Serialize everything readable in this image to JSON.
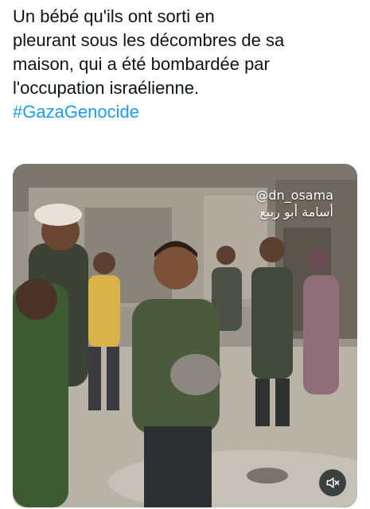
{
  "post": {
    "text_lines": [
      "Un bébé qu'ils ont sorti en",
      "pleurant sous les décombres de sa",
      "maison, qui a été bombardée par",
      "l'occupation israélienne."
    ],
    "hashtag": "#GazaGenocide"
  },
  "media": {
    "watermark_handle": "@dn_osama",
    "watermark_arabic": "أسامة أبو ربيع",
    "mute_icon": "speaker-muted-icon"
  },
  "colors": {
    "text": "#0f1419",
    "hashtag": "#1d9bf0",
    "overlay": "#0f1419"
  }
}
